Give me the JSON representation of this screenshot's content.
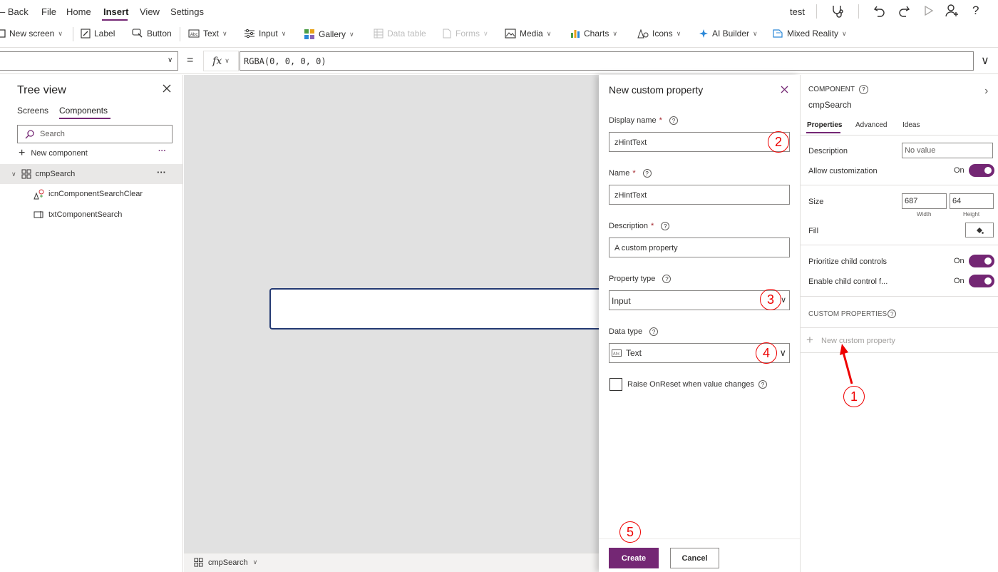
{
  "menu": {
    "back": "Back",
    "items": [
      "File",
      "Home",
      "Insert",
      "View",
      "Settings"
    ],
    "app_name": "test"
  },
  "toolbar": {
    "new_screen": "New screen",
    "label": "Label",
    "button": "Button",
    "text": "Text",
    "input": "Input",
    "gallery": "Gallery",
    "data_table": "Data table",
    "forms": "Forms",
    "media": "Media",
    "charts": "Charts",
    "icons": "Icons",
    "ai_builder": "AI Builder",
    "mixed_reality": "Mixed Reality"
  },
  "formula": {
    "equals": "=",
    "fx": "fx",
    "value": "RGBA(0, 0, 0, 0)"
  },
  "tree": {
    "title": "Tree view",
    "tabs": [
      "Screens",
      "Components"
    ],
    "search_placeholder": "Search",
    "new_component": "New component",
    "items": [
      {
        "label": "cmpSearch"
      },
      {
        "label": "icnComponentSearchClear"
      },
      {
        "label": "txtComponentSearch"
      }
    ]
  },
  "bottombar": {
    "component": "cmpSearch"
  },
  "panel": {
    "title": "New custom property",
    "display_name_label": "Display name",
    "display_name_value": "zHintText",
    "name_label": "Name",
    "name_value": "zHintText",
    "description_label": "Description",
    "description_value": "A custom property",
    "property_type_label": "Property type",
    "property_type_value": "Input",
    "data_type_label": "Data type",
    "data_type_value": "Text",
    "raise_onreset": "Raise OnReset when value changes",
    "create": "Create",
    "cancel": "Cancel",
    "required_mark": "*"
  },
  "annotations": [
    "1",
    "2",
    "3",
    "4",
    "5"
  ],
  "rightpane": {
    "section": "COMPONENT",
    "name": "cmpSearch",
    "tabs": [
      "Properties",
      "Advanced",
      "Ideas"
    ],
    "description_label": "Description",
    "description_value": "No value",
    "allow_custom_label": "Allow customization",
    "allow_custom_state": "On",
    "size_label": "Size",
    "width_value": "687",
    "height_value": "64",
    "width_caption": "Width",
    "height_caption": "Height",
    "fill_label": "Fill",
    "prioritize_label": "Prioritize child controls",
    "prioritize_state": "On",
    "enable_child_label": "Enable child control f...",
    "enable_child_state": "On",
    "custom_props_label": "CUSTOM PROPERTIES",
    "new_custom_property": "New custom property"
  },
  "colors": {
    "accent": "#742774",
    "annotation": "#e00000",
    "canvas": "#e1e1e1",
    "component_border": "#243a73"
  }
}
